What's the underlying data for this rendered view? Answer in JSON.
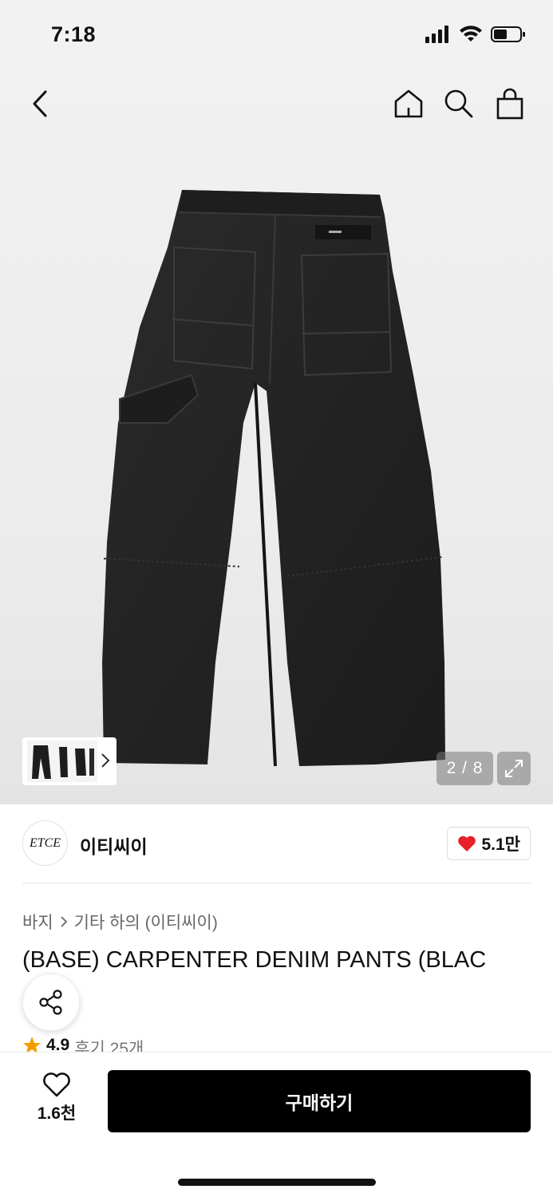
{
  "status_bar": {
    "time": "7:18",
    "icons": [
      "signal-icon",
      "wifi-icon",
      "battery-icon"
    ]
  },
  "nav": {
    "icons": [
      "back-icon",
      "home-icon",
      "search-icon",
      "cart-icon"
    ]
  },
  "gallery": {
    "counter": "2 / 8",
    "current": 2,
    "total": 8
  },
  "brand": {
    "logo_text": "ETCE",
    "name": "이티씨이",
    "like_count": "5.1만",
    "like_color": "#e8202a"
  },
  "breadcrumb": {
    "category": "바지",
    "separator": ">",
    "subcategory": "기타 하의 (이티씨이)"
  },
  "product": {
    "title": "(BASE) CARPENTER DENIM PANTS (BLAC"
  },
  "rating": {
    "score": "4.9",
    "reviews": "후기 25개",
    "star_color": "#f59b00"
  },
  "bottom_bar": {
    "wish_count": "1.6천",
    "buy_label": "구매하기"
  }
}
